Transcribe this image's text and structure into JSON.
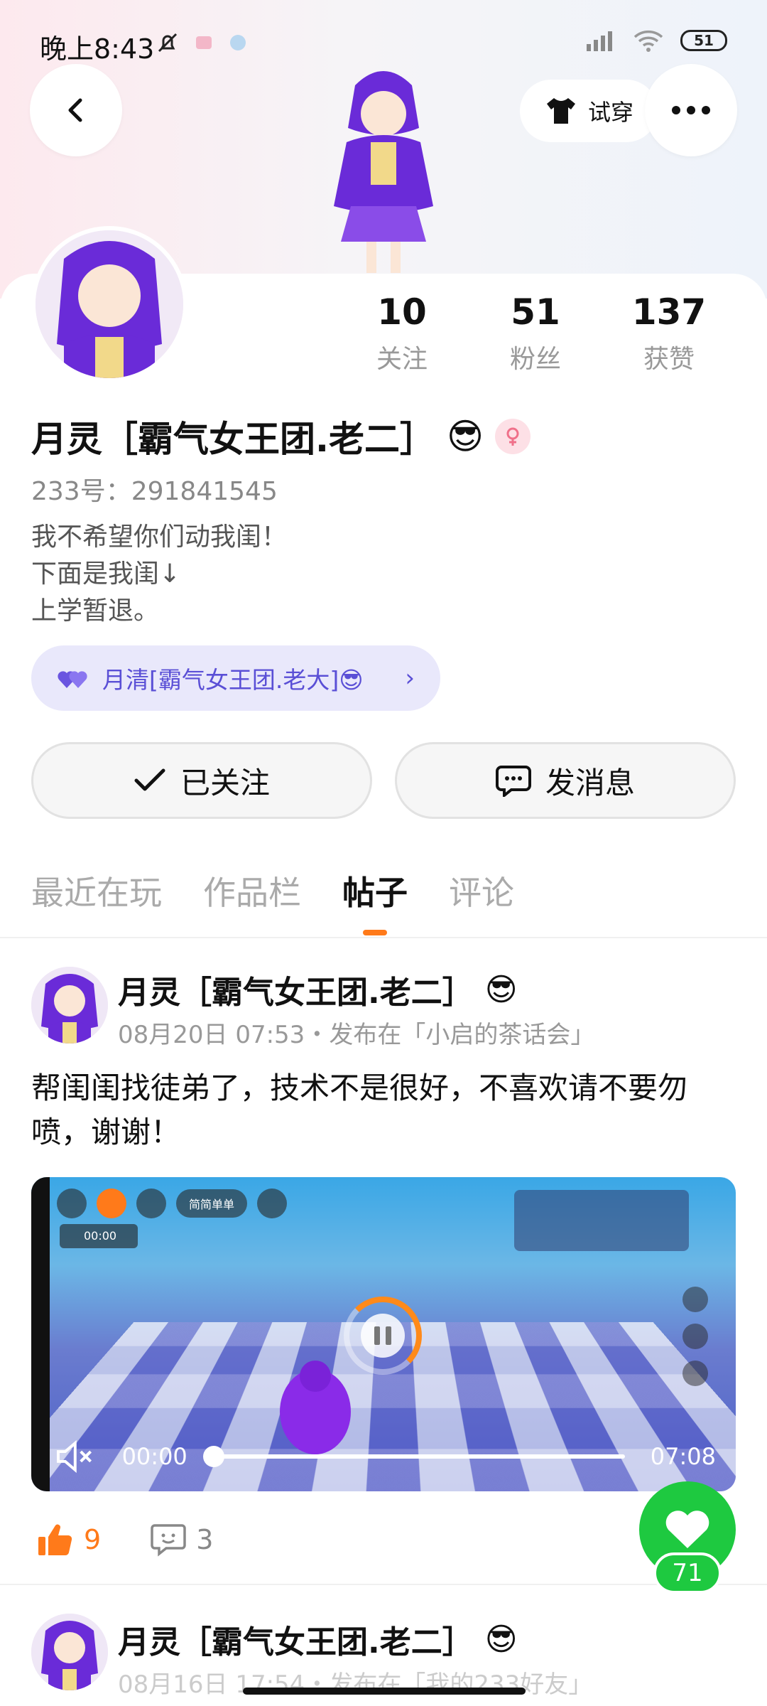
{
  "status_bar": {
    "time": "晚上8:43",
    "battery": "51"
  },
  "header": {
    "tryon_label": "试穿"
  },
  "profile": {
    "stats": [
      {
        "value": "10",
        "label": "关注"
      },
      {
        "value": "51",
        "label": "粉丝"
      },
      {
        "value": "137",
        "label": "获赞"
      }
    ],
    "name": "月灵［霸气女王团.老二］",
    "name_emoji": "😎",
    "uid": "233号：291841545",
    "bio_lines": [
      "我不希望你们动我闺！",
      "下面是我闺↓",
      "上学暂退。"
    ],
    "best_friend": "月清[霸气女王团.老大]😎"
  },
  "actions": {
    "follow_label": "已关注",
    "message_label": "发消息"
  },
  "tabs": [
    {
      "label": "最近在玩",
      "active": false
    },
    {
      "label": "作品栏",
      "active": false
    },
    {
      "label": "帖子",
      "active": true
    },
    {
      "label": "评论",
      "active": false
    }
  ],
  "post": {
    "author": "月灵［霸气女王团.老二］",
    "author_emoji": "😎",
    "meta": "08月20日 07:53・发布在「小启的茶话会」",
    "text": "帮闺闺找徒弟了，技术不是很好，不喜欢请不要勿喷，谢谢！",
    "video": {
      "current_time": "00:00",
      "duration": "07:08",
      "progress": 0.0,
      "pill_label": "简简单单",
      "record_time": "00:00"
    },
    "likes": "9",
    "comments": "3"
  },
  "fab": {
    "count": "71"
  },
  "post2": {
    "author": "月灵［霸气女王团.老二］",
    "author_emoji": "😎",
    "meta": "08月16日 17:54・发布在「我的233好友」"
  },
  "colors": {
    "accent_orange": "#ff7a1a",
    "fab_green": "#1ec940",
    "friend_purple": "#5a4fd6"
  }
}
